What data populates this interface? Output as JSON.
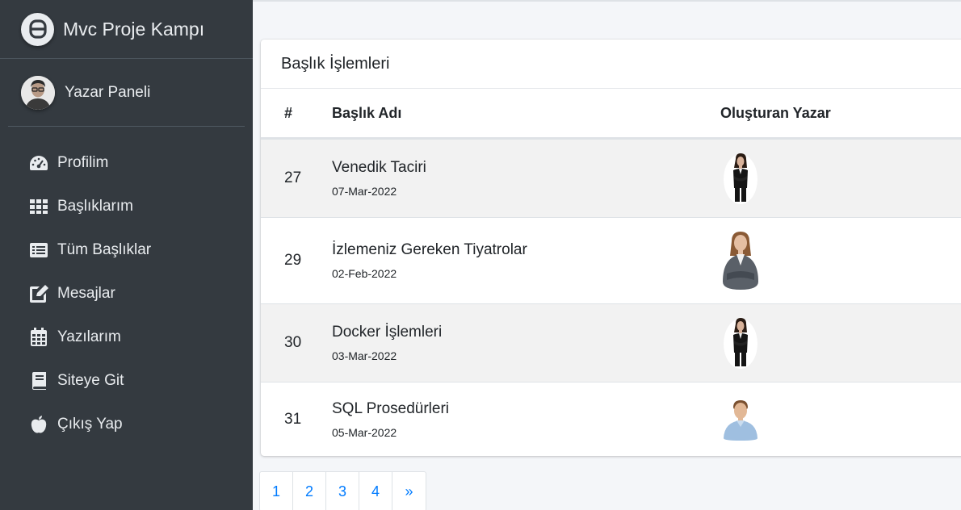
{
  "brand": {
    "title": "Mvc Proje Kampı"
  },
  "user": {
    "name": "Yazar Paneli"
  },
  "sidebar": {
    "items": [
      {
        "label": "Profilim",
        "icon": "dashboard-gauge-icon"
      },
      {
        "label": "Başlıklarım",
        "icon": "grid-icon"
      },
      {
        "label": "Tüm Başlıklar",
        "icon": "list-icon"
      },
      {
        "label": "Mesajlar",
        "icon": "edit-icon"
      },
      {
        "label": "Yazılarım",
        "icon": "calendar-icon"
      },
      {
        "label": "Siteye Git",
        "icon": "book-icon"
      },
      {
        "label": "Çıkış Yap",
        "icon": "apple-icon"
      }
    ]
  },
  "card": {
    "title": "Başlık İşlemleri",
    "columns": {
      "num": "#",
      "title": "Başlık Adı",
      "author": "Oluşturan Yazar"
    },
    "rows": [
      {
        "id": "27",
        "title": "Venedik Taciri",
        "date": "07-Mar-2022",
        "author_avatar": "woman-in-black-suit"
      },
      {
        "id": "29",
        "title": "İzlemeniz Gereken Tiyatrolar",
        "date": "02-Feb-2022",
        "author_avatar": "woman-crossed-arms"
      },
      {
        "id": "30",
        "title": "Docker İşlemleri",
        "date": "03-Mar-2022",
        "author_avatar": "woman-in-black-suit"
      },
      {
        "id": "31",
        "title": "SQL Prosedürleri",
        "date": "05-Mar-2022",
        "author_avatar": "man-in-blue-shirt"
      }
    ]
  },
  "pagination": {
    "pages": [
      "1",
      "2",
      "3",
      "4",
      "»"
    ]
  },
  "colors": {
    "sidebar": "#343a40",
    "link": "#007bff",
    "stripe": "#f2f2f2"
  }
}
